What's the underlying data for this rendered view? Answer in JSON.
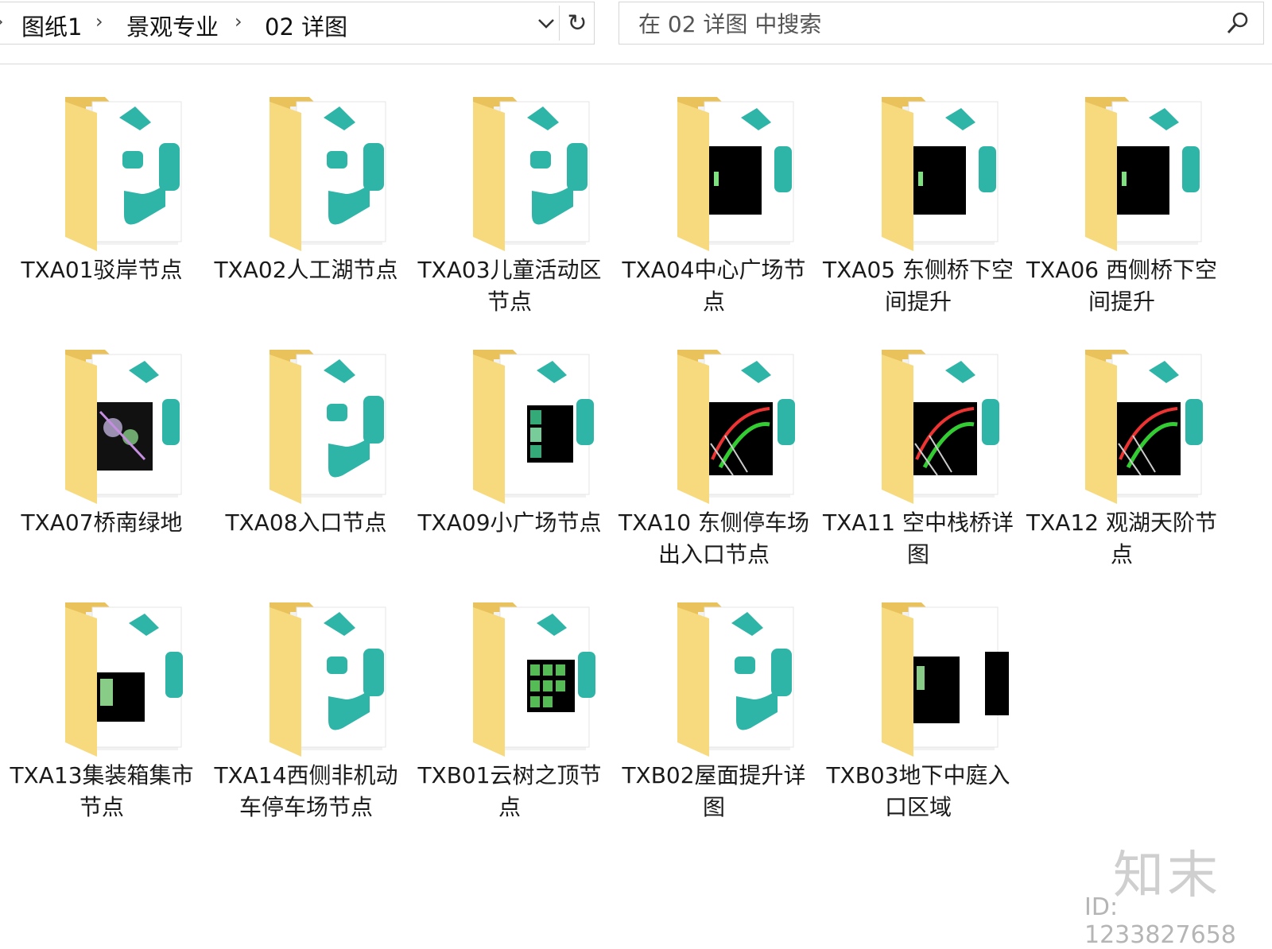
{
  "breadcrumb": {
    "items": [
      "图纸1",
      "景观专业",
      "02 详图"
    ],
    "separator": "›"
  },
  "search": {
    "placeholder": "在 02 详图 中搜索"
  },
  "folders": [
    {
      "name": "TXA01驳岸节点",
      "thumb": "logo"
    },
    {
      "name": "TXA02人工湖节点",
      "thumb": "logo"
    },
    {
      "name": "TXA03儿童活动区节点",
      "thumb": "logo"
    },
    {
      "name": "TXA04中心广场节点",
      "thumb": "cad-dark"
    },
    {
      "name": "TXA05 东侧桥下空间提升",
      "thumb": "cad-dark"
    },
    {
      "name": "TXA06 西侧桥下空间提升",
      "thumb": "cad-dark"
    },
    {
      "name": "TXA07桥南绿地",
      "thumb": "cad-plan"
    },
    {
      "name": "TXA08入口节点",
      "thumb": "logo"
    },
    {
      "name": "TXA09小广场节点",
      "thumb": "cad-grid"
    },
    {
      "name": "TXA10 东侧停车场出入口节点",
      "thumb": "cad-color"
    },
    {
      "name": "TXA11 空中栈桥详图",
      "thumb": "cad-color"
    },
    {
      "name": "TXA12 观湖天阶节点",
      "thumb": "cad-color"
    },
    {
      "name": "TXA13集装箱集市节点",
      "thumb": "cad-small"
    },
    {
      "name": "TXA14西侧非机动车停车场节点",
      "thumb": "logo"
    },
    {
      "name": "TXB01云树之顶节点",
      "thumb": "cad-grid6"
    },
    {
      "name": "TXB02屋面提升详图",
      "thumb": "logo"
    },
    {
      "name": "TXB03地下中庭入口区域",
      "thumb": "cad-double"
    }
  ],
  "watermark": {
    "logo": "知末",
    "id": "ID: 1233827658"
  },
  "colors": {
    "folder_back": "#e9c25b",
    "folder_front": "#f7d97e",
    "teal": "#2fb5a8",
    "paper": "#ffffff"
  }
}
